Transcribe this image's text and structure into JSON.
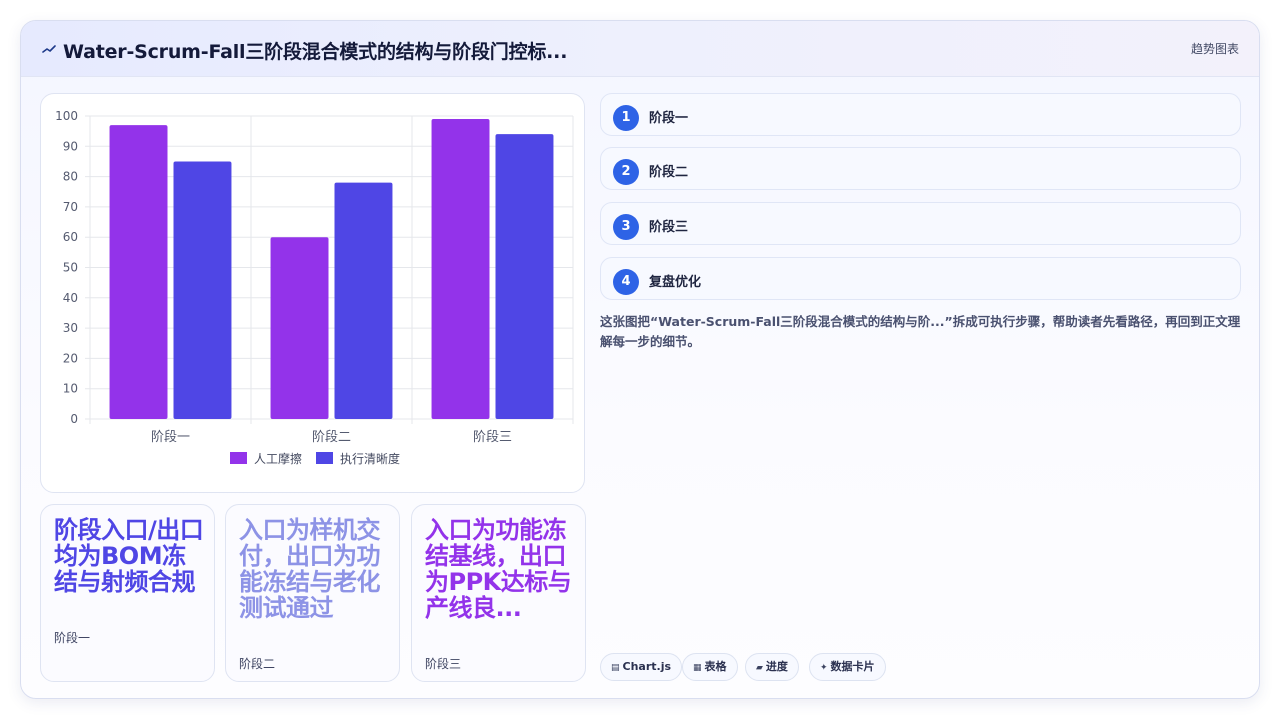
{
  "header": {
    "title": "Water-Scrum-Fall三阶段混合模式的结构与阶段门控标...",
    "link_label": "趋势图表",
    "icon": "trend-arrow-icon"
  },
  "chart_data": {
    "type": "bar",
    "categories": [
      "阶段一",
      "阶段二",
      "阶段三"
    ],
    "series": [
      {
        "name": "人工摩擦",
        "values": [
          97,
          60,
          99
        ],
        "color": "#9333ea"
      },
      {
        "name": "执行清晰度",
        "values": [
          85,
          78,
          94
        ],
        "color": "#4f46e5"
      }
    ],
    "ylim": [
      0,
      100
    ],
    "yticks": [
      0,
      10,
      20,
      30,
      40,
      50,
      60,
      70,
      80,
      90,
      100
    ],
    "grid": true,
    "legend_position": "bottom"
  },
  "steps": [
    {
      "num": "1",
      "label": "阶段一"
    },
    {
      "num": "2",
      "label": "阶段二"
    },
    {
      "num": "3",
      "label": "阶段三"
    },
    {
      "num": "4",
      "label": "复盘优化"
    }
  ],
  "description": "这张图把“Water-Scrum-Fall三阶段混合模式的结构与阶...”拆成可执行步骤，帮助读者先看路径，再回到正文理解每一步的细节。",
  "tiles": [
    {
      "big": "阶段入口/出口均为BOM冻结与射频合规",
      "small": "阶段一",
      "color": "#4f46e5"
    },
    {
      "big": "入口为样机交付，出口为功能冻结与老化测试通过",
      "small": "阶段二",
      "color": "#8d93e6"
    },
    {
      "big": "入口为功能冻结基线，出口为PPK达标与产线良...",
      "small": "阶段三",
      "color": "#9333ea"
    }
  ],
  "tags": [
    {
      "icon": "chart-icon",
      "label": "Chart.js"
    },
    {
      "icon": "table-icon",
      "label": "表格"
    },
    {
      "icon": "progress-icon",
      "label": "进度"
    },
    {
      "icon": "sparkle-icon",
      "label": "数据卡片"
    }
  ]
}
